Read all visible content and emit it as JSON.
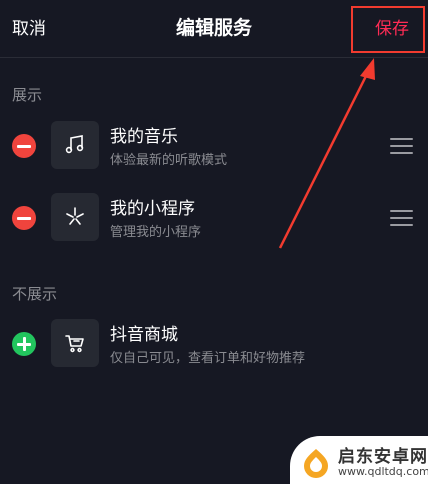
{
  "header": {
    "cancel_label": "取消",
    "title": "编辑服务",
    "save_label": "保存"
  },
  "shown_section": {
    "label": "展示",
    "items": [
      {
        "name": "我的音乐",
        "desc": "体验最新的听歌模式",
        "icon": "music-note-icon",
        "action": "remove"
      },
      {
        "name": "我的小程序",
        "desc": "管理我的小程序",
        "icon": "mini-program-icon",
        "action": "remove"
      }
    ]
  },
  "hidden_section": {
    "label": "不展示",
    "items": [
      {
        "name": "抖音商城",
        "desc": "仅自己可见，查看订单和好物推荐",
        "icon": "shopping-cart-icon",
        "action": "add"
      }
    ]
  },
  "watermark": {
    "title": "启东安卓网",
    "url": "www.qdltdq.com"
  },
  "colors": {
    "background": "#161823",
    "accent": "#fe2c55",
    "remove": "#f0443d",
    "add": "#22c55e",
    "annotation": "#f23b2f"
  }
}
